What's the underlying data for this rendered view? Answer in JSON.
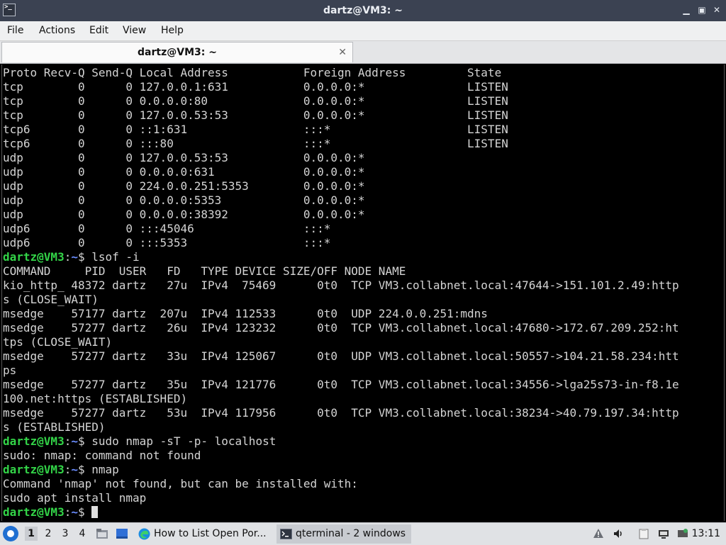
{
  "window": {
    "title": "dartz@VM3: ~"
  },
  "menu": [
    "File",
    "Actions",
    "Edit",
    "View",
    "Help"
  ],
  "tab": {
    "label": "dartz@VM3: ~",
    "close": "✕"
  },
  "terminal": {
    "lines": [
      [
        {
          "t": "Proto Recv-Q Send-Q Local Address           Foreign Address         State"
        }
      ],
      [
        {
          "t": "tcp        0      0 127.0.0.1:631           0.0.0.0:*               LISTEN"
        }
      ],
      [
        {
          "t": "tcp        0      0 0.0.0.0:80              0.0.0.0:*               LISTEN"
        }
      ],
      [
        {
          "t": "tcp        0      0 127.0.0.53:53           0.0.0.0:*               LISTEN"
        }
      ],
      [
        {
          "t": "tcp6       0      0 ::1:631                 :::*                    LISTEN"
        }
      ],
      [
        {
          "t": "tcp6       0      0 :::80                   :::*                    LISTEN"
        }
      ],
      [
        {
          "t": "udp        0      0 127.0.0.53:53           0.0.0.0:*"
        }
      ],
      [
        {
          "t": "udp        0      0 0.0.0.0:631             0.0.0.0:*"
        }
      ],
      [
        {
          "t": "udp        0      0 224.0.0.251:5353        0.0.0.0:*"
        }
      ],
      [
        {
          "t": "udp        0      0 0.0.0.0:5353            0.0.0.0:*"
        }
      ],
      [
        {
          "t": "udp        0      0 0.0.0.0:38392           0.0.0.0:*"
        }
      ],
      [
        {
          "t": "udp6       0      0 :::45046                :::*"
        }
      ],
      [
        {
          "t": "udp6       0      0 :::5353                 :::*"
        }
      ],
      [
        {
          "t": "dartz@VM3",
          "c": "prompt"
        },
        {
          "t": ":"
        },
        {
          "t": "~",
          "c": "path"
        },
        {
          "t": "$ lsof -i"
        }
      ],
      [
        {
          "t": "COMMAND     PID  USER   FD   TYPE DEVICE SIZE/OFF NODE NAME"
        }
      ],
      [
        {
          "t": "kio_http_ 48372 dartz   27u  IPv4  75469      0t0  TCP VM3.collabnet.local:47644->151.101.2.49:http"
        }
      ],
      [
        {
          "t": "s (CLOSE_WAIT)"
        }
      ],
      [
        {
          "t": "msedge    57177 dartz  207u  IPv4 112533      0t0  UDP 224.0.0.251:mdns"
        }
      ],
      [
        {
          "t": "msedge    57277 dartz   26u  IPv4 123232      0t0  TCP VM3.collabnet.local:47680->172.67.209.252:ht"
        }
      ],
      [
        {
          "t": "tps (CLOSE_WAIT)"
        }
      ],
      [
        {
          "t": "msedge    57277 dartz   33u  IPv4 125067      0t0  UDP VM3.collabnet.local:50557->104.21.58.234:htt"
        }
      ],
      [
        {
          "t": "ps"
        }
      ],
      [
        {
          "t": "msedge    57277 dartz   35u  IPv4 121776      0t0  TCP VM3.collabnet.local:34556->lga25s73-in-f8.1e"
        }
      ],
      [
        {
          "t": "100.net:https (ESTABLISHED)"
        }
      ],
      [
        {
          "t": "msedge    57277 dartz   53u  IPv4 117956      0t0  TCP VM3.collabnet.local:38234->40.79.197.34:http"
        }
      ],
      [
        {
          "t": "s (ESTABLISHED)"
        }
      ],
      [
        {
          "t": "dartz@VM3",
          "c": "prompt"
        },
        {
          "t": ":"
        },
        {
          "t": "~",
          "c": "path"
        },
        {
          "t": "$ sudo nmap -sT -p- localhost"
        }
      ],
      [
        {
          "t": "sudo: nmap: command not found"
        }
      ],
      [
        {
          "t": "dartz@VM3",
          "c": "prompt"
        },
        {
          "t": ":"
        },
        {
          "t": "~",
          "c": "path"
        },
        {
          "t": "$ nmap"
        }
      ],
      [
        {
          "t": "Command 'nmap' not found, but can be installed with:"
        }
      ],
      [
        {
          "t": "sudo apt install nmap"
        }
      ],
      [
        {
          "t": "dartz@VM3",
          "c": "prompt"
        },
        {
          "t": ":"
        },
        {
          "t": "~",
          "c": "path"
        },
        {
          "t": "$ "
        }
      ]
    ]
  },
  "taskbar": {
    "desktops": [
      "1",
      "2",
      "3",
      "4"
    ],
    "active_desktop": "1",
    "tasks": [
      {
        "label": "How to List Open Por...",
        "icon": "edge-browser-icon"
      },
      {
        "label": "qterminal - 2 windows",
        "icon": "terminal-icon"
      }
    ],
    "clock": "13:11"
  },
  "colors": {
    "prompt": "#33d448",
    "path": "#6a8dff",
    "terminal_bg": "#000000"
  }
}
